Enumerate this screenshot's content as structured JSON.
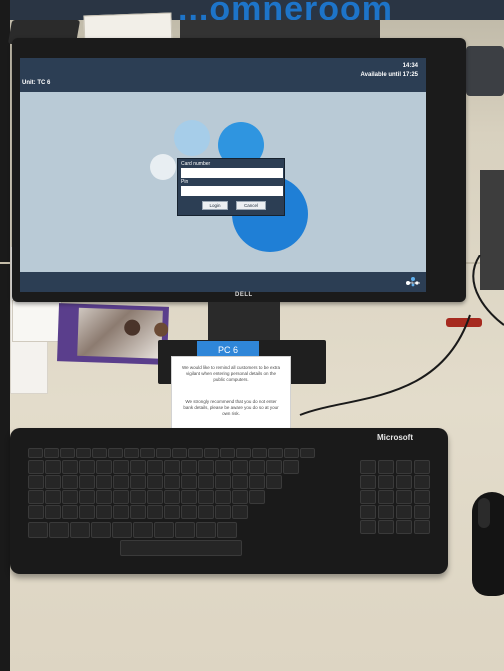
{
  "banner": {
    "text": "...omneroom"
  },
  "screen": {
    "unit_label": "Unit: TC 6",
    "time": "14:34",
    "available": "Available until 17:25",
    "logo_text": "netloan"
  },
  "login_dialog": {
    "card_label": "Card number",
    "pin_label": "Pin",
    "login_button": "Login",
    "cancel_button": "Cancel"
  },
  "monitor": {
    "brand": "DELL"
  },
  "pc_tag": {
    "label": "PC 6"
  },
  "notice": {
    "para1": "We would like to remind all customers to be extra vigilant when entering personal details on the public computers.",
    "para2": "We strongly recommend that you do not enter bank details, please be aware you do so at your own risk."
  },
  "keyboard": {
    "brand": "Microsoft"
  },
  "colors": {
    "screen_bar": "#2c3e54",
    "bubble_blue": "#1f7fd6",
    "pc_tag": "#2f86d8"
  }
}
